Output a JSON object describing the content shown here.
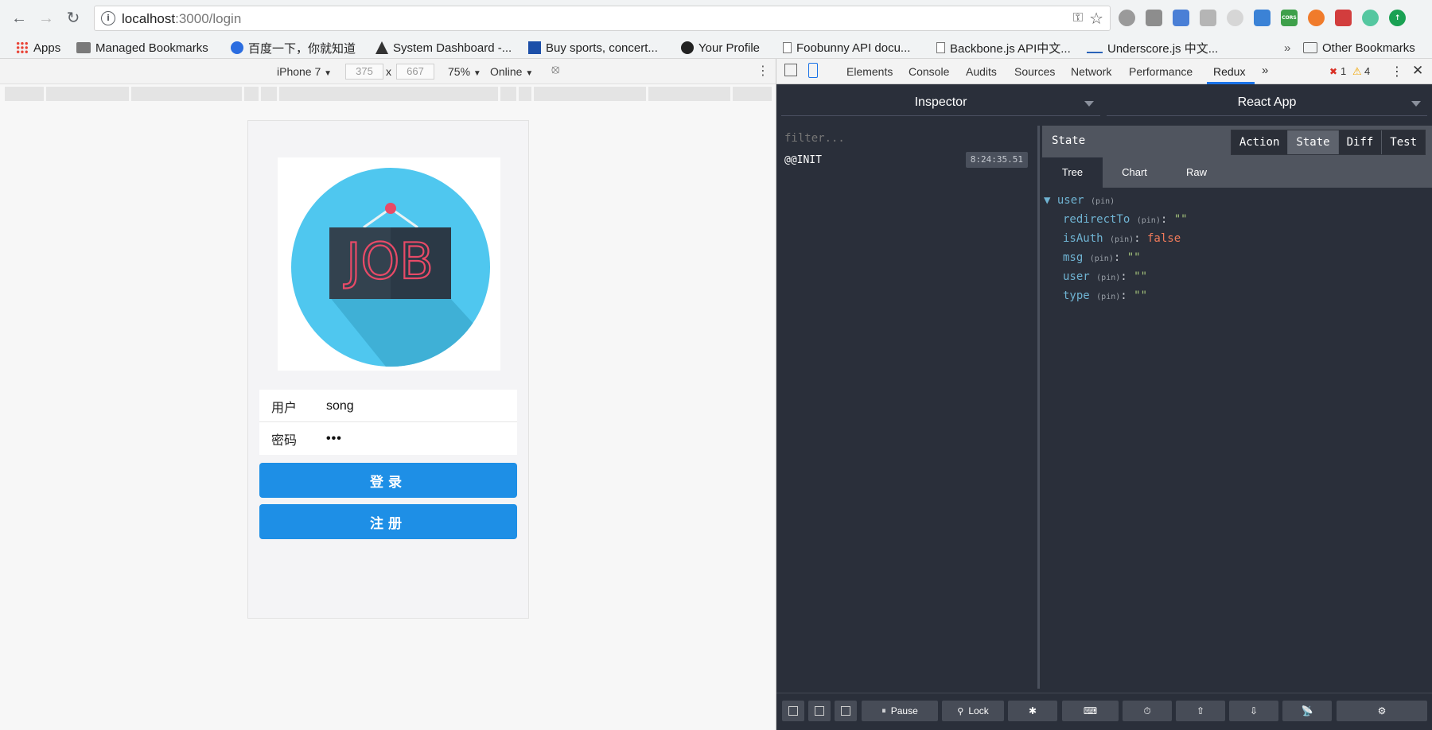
{
  "browser": {
    "url_host": "localhost",
    "url_path": ":3000/login",
    "bookmarks": [
      "Apps",
      "Managed Bookmarks",
      "百度一下，你就知道",
      "System Dashboard -...",
      "Buy sports, concert...",
      "Your Profile",
      "Foobunny API docu...",
      "Backbone.js API中文...",
      "Underscore.js 中文...",
      "Other Bookmarks"
    ],
    "overflow_label": "»",
    "extension_icons": [
      "globe-icon",
      "camera-icon",
      "pen-icon",
      "cloud-icon",
      "bulb-icon",
      "dev-icon",
      "cors-icon",
      "orange-icon",
      "puzzle-icon",
      "sync-icon",
      "green-up-icon"
    ],
    "ext_cors_label": "CORS"
  },
  "device_toolbar": {
    "device": "iPhone 7",
    "width": "375",
    "times": "x",
    "height": "667",
    "zoom": "75%",
    "network": "Online"
  },
  "login_page": {
    "logo_text": "JOB",
    "user_label": "用户",
    "user_value": "song",
    "password_label": "密码",
    "password_value": "•••",
    "login_button": "登录",
    "register_button": "注册"
  },
  "devtools": {
    "tabs": [
      "Elements",
      "Console",
      "Audits",
      "Sources",
      "Network",
      "Performance",
      "Redux"
    ],
    "active_tab": "Redux",
    "more_tabs": "»",
    "error_count": "1",
    "warning_count": "4",
    "redux": {
      "left_select": "Inspector",
      "right_select": "React App",
      "filter_placeholder": "filter...",
      "action_name": "@@INIT",
      "action_time": "8:24:35.51",
      "state_title": "State",
      "modes": [
        "Action",
        "State",
        "Diff",
        "Test"
      ],
      "active_mode": "State",
      "views": [
        "Tree",
        "Chart",
        "Raw"
      ],
      "active_view": "Tree",
      "pin_label": "(pin)",
      "tree": {
        "root_key": "user",
        "entries": [
          {
            "key": "redirectTo",
            "value": "\"\"",
            "kind": "string"
          },
          {
            "key": "isAuth",
            "value": "false",
            "kind": "boolean"
          },
          {
            "key": "msg",
            "value": "\"\"",
            "kind": "string"
          },
          {
            "key": "user",
            "value": "\"\"",
            "kind": "string"
          },
          {
            "key": "type",
            "value": "\"\"",
            "kind": "string"
          }
        ]
      },
      "footer": {
        "pause": "Pause",
        "lock": "Lock"
      }
    }
  },
  "colors": {
    "primary_button": "#1e8fe6",
    "devtools_bg": "#2a2f3a",
    "tree_key": "#6fb3d2",
    "tree_string": "#a2c07a",
    "tree_boolean": "#f07a5a"
  }
}
